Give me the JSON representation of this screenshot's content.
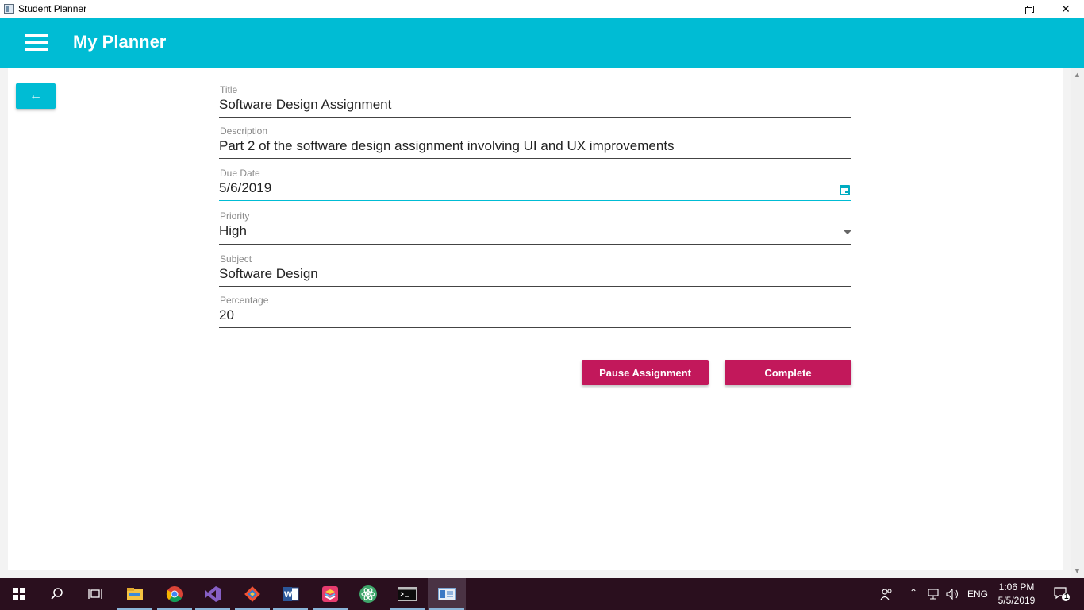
{
  "window": {
    "title": "Student Planner"
  },
  "appbar": {
    "title": "My Planner"
  },
  "back_button": {
    "label": "←"
  },
  "form": {
    "title": {
      "label": "Title",
      "value": "Software Design Assignment"
    },
    "description": {
      "label": "Description",
      "value": "Part 2 of the software design assignment involving UI and UX improvements"
    },
    "due_date": {
      "label": "Due Date",
      "value": "5/6/2019"
    },
    "priority": {
      "label": "Priority",
      "value": "High"
    },
    "subject": {
      "label": "Subject",
      "value": "Software Design"
    },
    "percentage": {
      "label": "Percentage",
      "value": "20"
    }
  },
  "actions": {
    "pause_label": "Pause Assignment",
    "complete_label": "Complete"
  },
  "colors": {
    "primary": "#00bcd4",
    "accent": "#c2185b"
  },
  "taskbar": {
    "apps": [
      "start-icon",
      "search-icon",
      "task-view-icon",
      "file-explorer-icon",
      "chrome-icon",
      "visual-studio-icon",
      "git-icon",
      "word-icon",
      "layers-app-icon",
      "atom-icon",
      "terminal-icon",
      "student-planner-icon"
    ],
    "language": "ENG",
    "time": "1:06 PM",
    "date": "5/5/2019",
    "notification_count": "1"
  }
}
